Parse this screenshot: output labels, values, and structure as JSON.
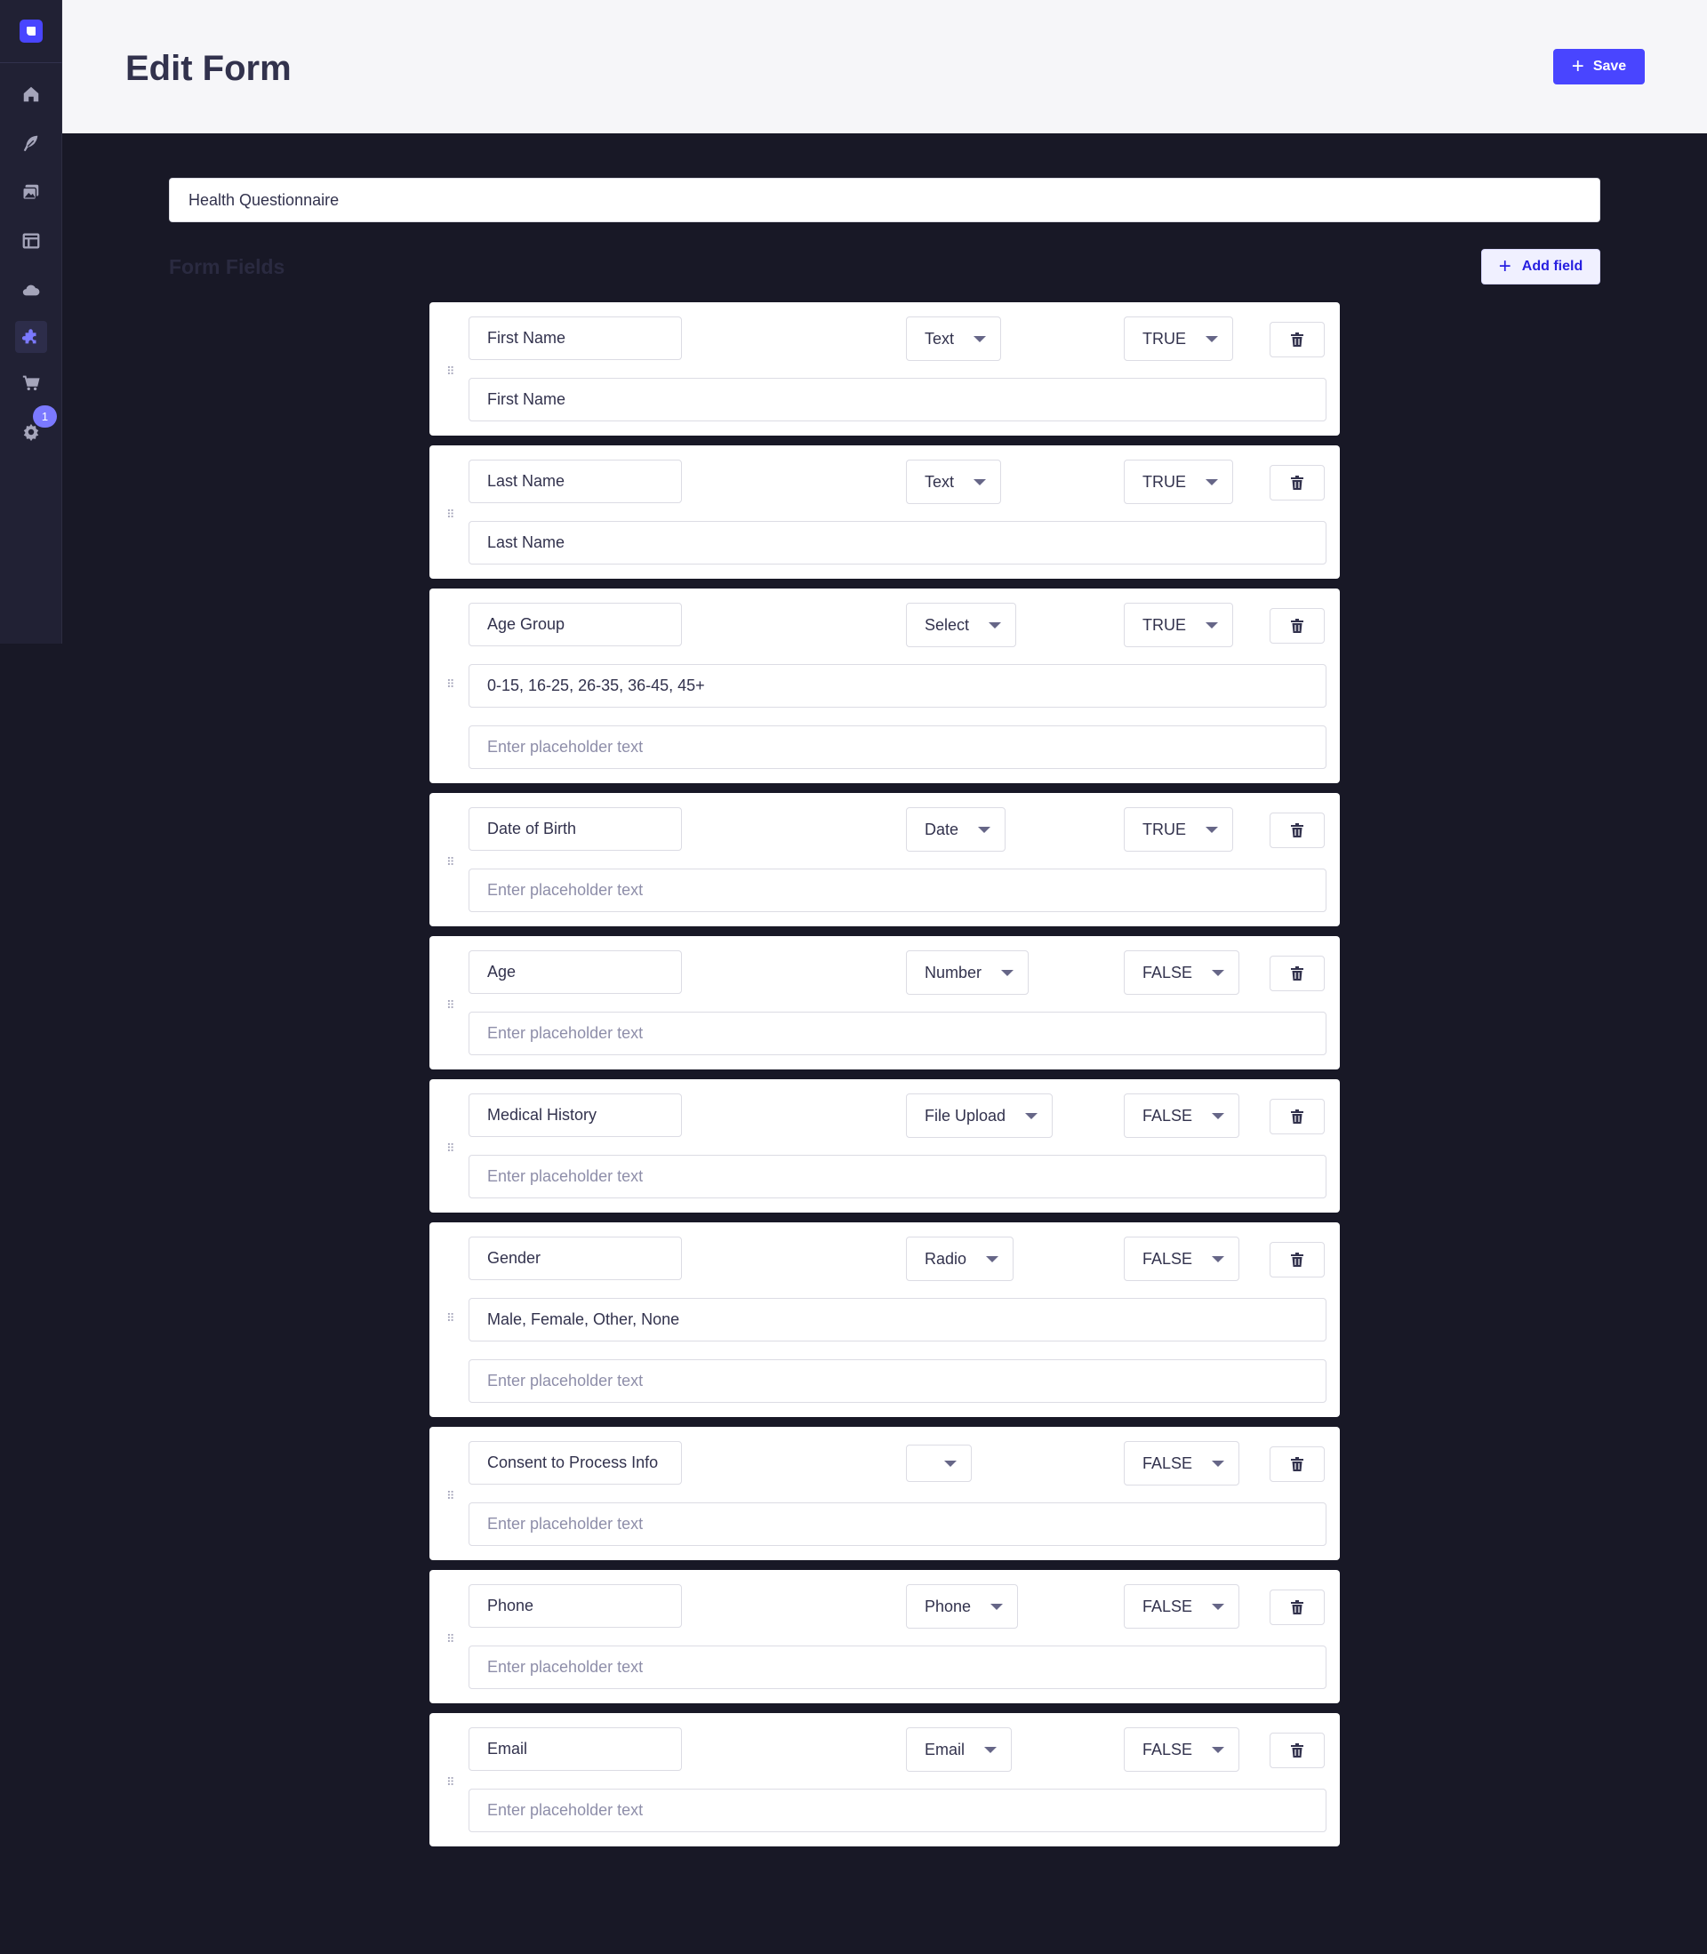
{
  "header": {
    "title": "Edit Form",
    "save_label": "Save"
  },
  "form": {
    "name": "Health Questionnaire"
  },
  "section": {
    "title": "Form Fields",
    "add_label": "Add field"
  },
  "sidebar": {
    "items": [
      {
        "icon": "home-icon"
      },
      {
        "icon": "feather-icon"
      },
      {
        "icon": "media-icon"
      },
      {
        "icon": "layout-icon"
      },
      {
        "icon": "cloud-icon"
      },
      {
        "icon": "puzzle-icon"
      },
      {
        "icon": "cart-icon"
      },
      {
        "icon": "gear-icon"
      }
    ],
    "badge": "1"
  },
  "fields": [
    {
      "label": "First Name",
      "type": "Text",
      "required": "TRUE",
      "placeholder_value": "First Name"
    },
    {
      "label": "Last Name",
      "type": "Text",
      "required": "TRUE",
      "placeholder_value": "Last Name"
    },
    {
      "label": "Age Group",
      "type": "Select",
      "required": "TRUE",
      "options": "0-15, 16-25, 26-35, 36-45, 45+",
      "placeholder_hint": "Enter placeholder text"
    },
    {
      "label": "Date of Birth",
      "type": "Date",
      "required": "TRUE",
      "placeholder_hint": "Enter placeholder text"
    },
    {
      "label": "Age",
      "type": "Number",
      "required": "FALSE",
      "placeholder_hint": "Enter placeholder text"
    },
    {
      "label": "Medical History",
      "type": "File Upload",
      "required": "FALSE",
      "placeholder_hint": "Enter placeholder text"
    },
    {
      "label": "Gender",
      "type": "Radio",
      "required": "FALSE",
      "options": "Male, Female, Other, None",
      "placeholder_hint": "Enter placeholder text"
    },
    {
      "label": "Consent to Process Info",
      "type": "",
      "required": "FALSE",
      "placeholder_hint": "Enter placeholder text"
    },
    {
      "label": "Phone",
      "type": "Phone",
      "required": "FALSE",
      "placeholder_hint": "Enter placeholder text"
    },
    {
      "label": "Email",
      "type": "Email",
      "required": "FALSE",
      "placeholder_hint": "Enter placeholder text"
    }
  ],
  "colors": {
    "accent": "#4945ff",
    "background": "#181826",
    "header": "#f6f6f9",
    "sidebar": "#212134"
  }
}
